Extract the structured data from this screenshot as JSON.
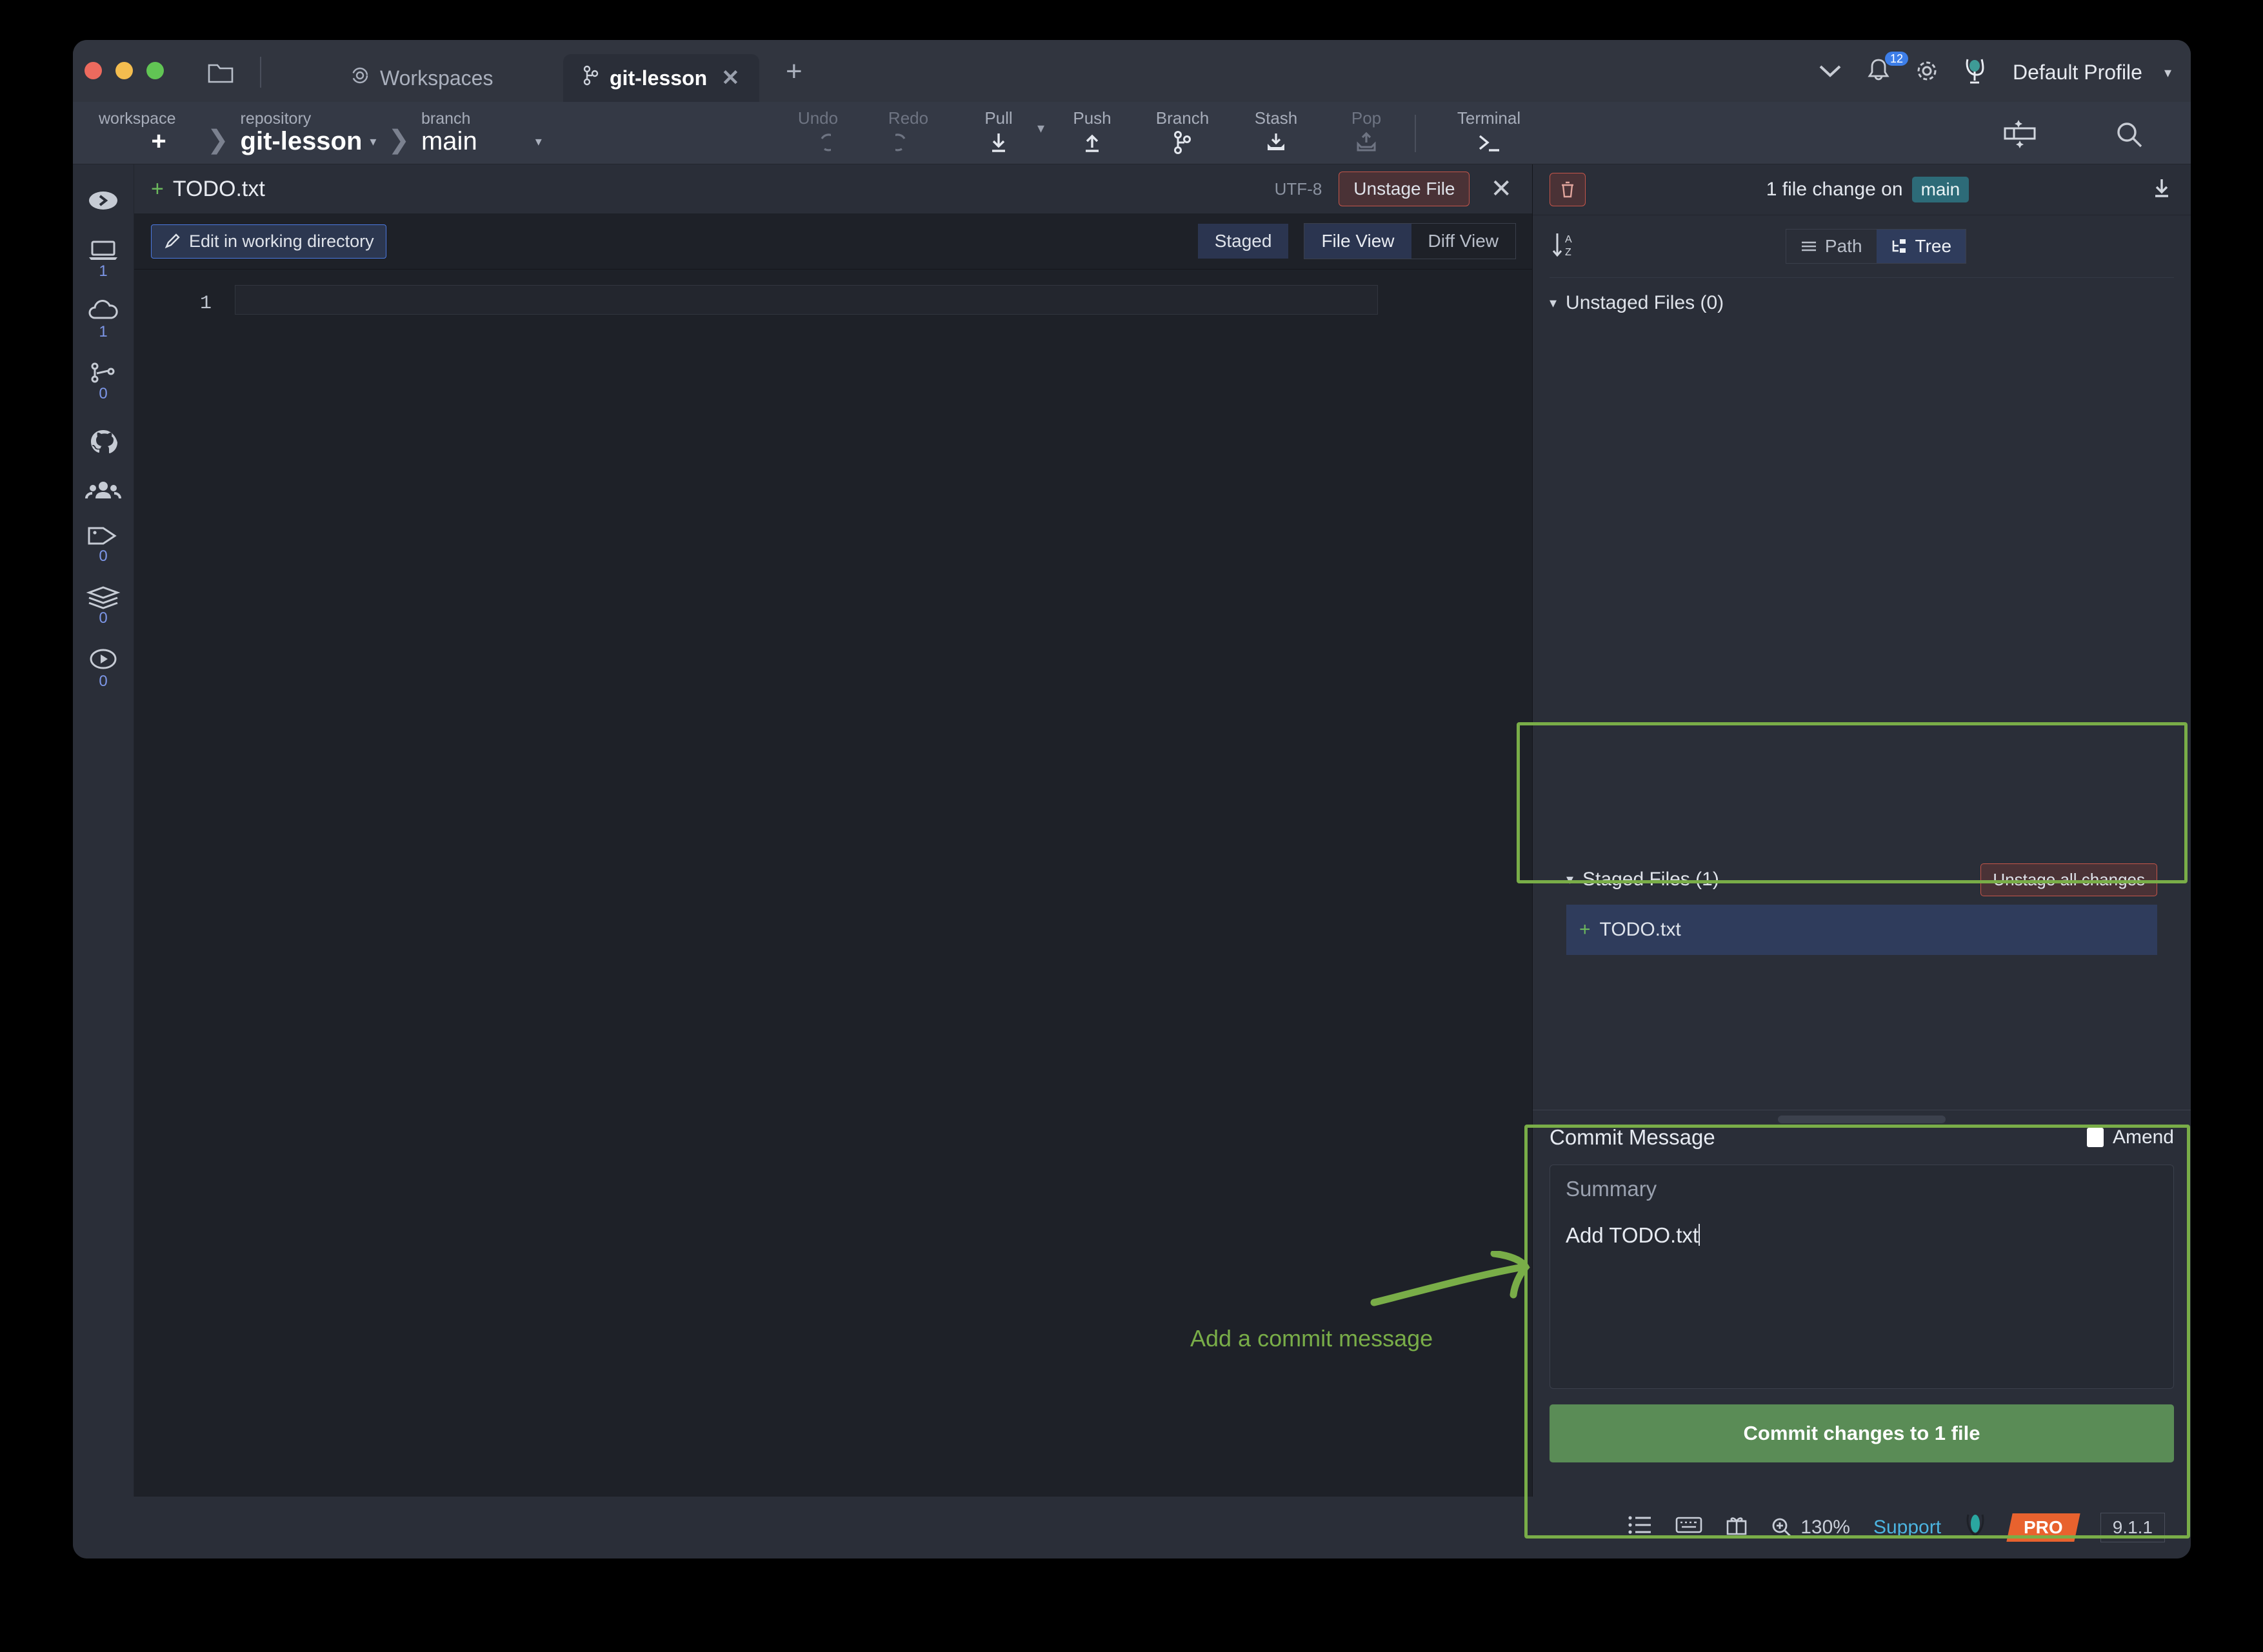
{
  "window": {
    "title_tabs": [
      {
        "label": "Workspaces",
        "icon": "workspaces-icon",
        "active": false
      },
      {
        "label": "git-lesson",
        "icon": "branch-icon",
        "active": true
      }
    ],
    "new_tab_label": "+",
    "folder_icon": "folder-icon",
    "notifications_count": "12",
    "profile_label": "Default Profile",
    "chevron_down": "⌄"
  },
  "toolbar": {
    "crumbs": [
      {
        "label": "workspace",
        "value": "+"
      },
      {
        "label": "repository",
        "value": "git-lesson"
      },
      {
        "label": "branch",
        "value": "main"
      }
    ],
    "actions": [
      {
        "label": "Undo",
        "icon": "undo-icon",
        "disabled": true
      },
      {
        "label": "Redo",
        "icon": "redo-icon",
        "disabled": true
      },
      {
        "label": "Pull",
        "icon": "pull-icon",
        "disabled": false
      },
      {
        "label": "Push",
        "icon": "push-icon",
        "disabled": false
      },
      {
        "label": "Branch",
        "icon": "branch-icon",
        "disabled": false
      },
      {
        "label": "Stash",
        "icon": "stash-icon",
        "disabled": false
      },
      {
        "label": "Pop",
        "icon": "pop-icon",
        "disabled": true
      },
      {
        "label": "Terminal",
        "icon": "terminal-icon",
        "disabled": false
      }
    ],
    "layout_icon": "panel-layout-icon",
    "search_icon": "search-icon"
  },
  "sidebar": {
    "items": [
      {
        "name": "collapse-toggle",
        "icon": "chevron-right-circle-icon",
        "count": ""
      },
      {
        "name": "local-repos",
        "icon": "laptop-icon",
        "count": "1"
      },
      {
        "name": "remote-repos",
        "icon": "cloud-icon",
        "count": "1"
      },
      {
        "name": "pull-requests",
        "icon": "pull-request-icon",
        "count": "0"
      },
      {
        "name": "github",
        "icon": "github-icon",
        "count": ""
      },
      {
        "name": "team",
        "icon": "people-icon",
        "count": ""
      },
      {
        "name": "tags",
        "icon": "tag-icon",
        "count": "0"
      },
      {
        "name": "stashes",
        "icon": "layers-icon",
        "count": "0"
      },
      {
        "name": "actions",
        "icon": "play-circle-icon",
        "count": "0"
      }
    ]
  },
  "file_view": {
    "filename": "TODO.txt",
    "status_glyph": "+",
    "encoding": "UTF-8",
    "unstage_file_label": "Unstage File",
    "close_icon": "close-icon",
    "edit_button_label": "Edit in working directory",
    "edit_icon": "pencil-icon",
    "staged_pill": "Staged",
    "file_view_label": "File View",
    "diff_view_label": "Diff View",
    "lines": [
      {
        "number": "1",
        "text": ""
      }
    ]
  },
  "changes_panel": {
    "discard_icon": "trash-icon",
    "header_text": "1 file change on",
    "branch": "main",
    "download_icon": "download-icon",
    "sort_icon": "sort-az-icon",
    "path_label": "Path",
    "tree_label": "Tree",
    "unstaged_header": "Unstaged Files (0)",
    "staged_header": "Staged Files (1)",
    "unstage_all_label": "Unstage all changes",
    "staged_files": [
      {
        "name": "TODO.txt",
        "glyph": "+"
      }
    ]
  },
  "commit": {
    "title": "Commit Message",
    "amend_label": "Amend",
    "summary_placeholder": "Summary",
    "message_value": "Add TODO.txt",
    "button_label": "Commit changes to 1 file"
  },
  "status_bar": {
    "list_icon": "list-icon",
    "keyboard_icon": "keyboard-icon",
    "gift_icon": "gift-icon",
    "zoom_icon": "zoom-in-icon",
    "zoom_level": "130%",
    "support_label": "Support",
    "kraken_icon": "kraken-icon",
    "pro_label": "PRO",
    "version": "9.1.1"
  },
  "annotations": {
    "commit_message_note": "Add a commit message",
    "highlight_color": "#79ad48"
  }
}
